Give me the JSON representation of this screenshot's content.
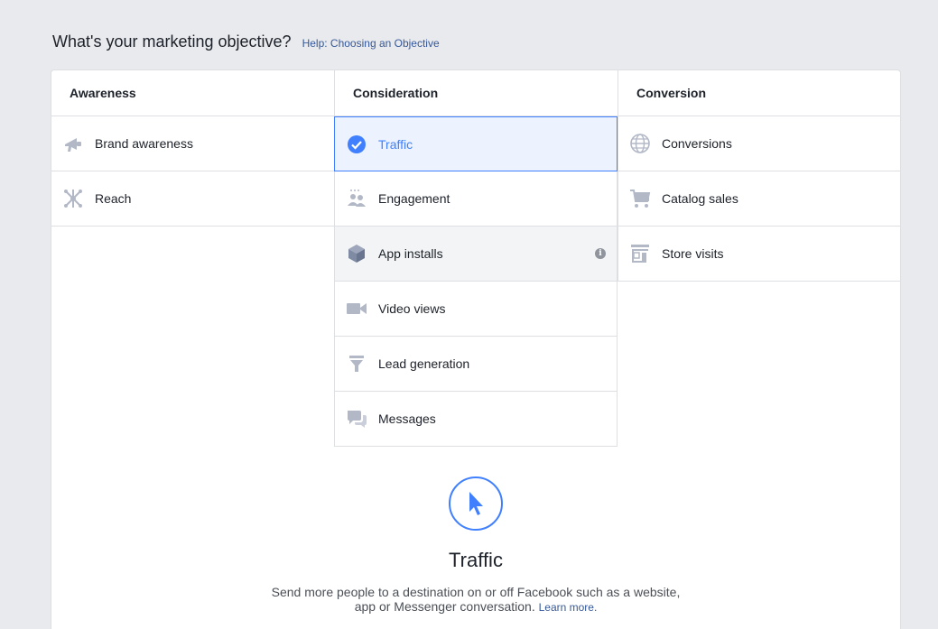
{
  "header": {
    "title": "What's your marketing objective?",
    "help_link": "Help: Choosing an Objective"
  },
  "columns": {
    "awareness": {
      "heading": "Awareness",
      "items": [
        {
          "label": "Brand awareness",
          "icon": "megaphone-icon"
        },
        {
          "label": "Reach",
          "icon": "reach-icon"
        }
      ]
    },
    "consideration": {
      "heading": "Consideration",
      "items": [
        {
          "label": "Traffic",
          "icon": "check-circle-icon",
          "selected": true
        },
        {
          "label": "Engagement",
          "icon": "people-icon"
        },
        {
          "label": "App installs",
          "icon": "cube-icon"
        },
        {
          "label": "Video views",
          "icon": "video-camera-icon"
        },
        {
          "label": "Lead generation",
          "icon": "funnel-icon"
        },
        {
          "label": "Messages",
          "icon": "chat-bubbles-icon"
        }
      ]
    },
    "conversion": {
      "heading": "Conversion",
      "items": [
        {
          "label": "Conversions",
          "icon": "globe-icon"
        },
        {
          "label": "Catalog sales",
          "icon": "cart-icon"
        },
        {
          "label": "Store visits",
          "icon": "store-icon"
        }
      ]
    }
  },
  "detail": {
    "icon": "cursor-icon",
    "title": "Traffic",
    "description_line1": "Send more people to a destination on or off Facebook such as a website,",
    "description_line2": "app or Messenger conversation.",
    "learn_more": "Learn more."
  },
  "colors": {
    "accent": "#4080ff",
    "selected_bg": "#ecf3ff",
    "link": "#365899",
    "icon_gray": "#a9b2c6"
  }
}
